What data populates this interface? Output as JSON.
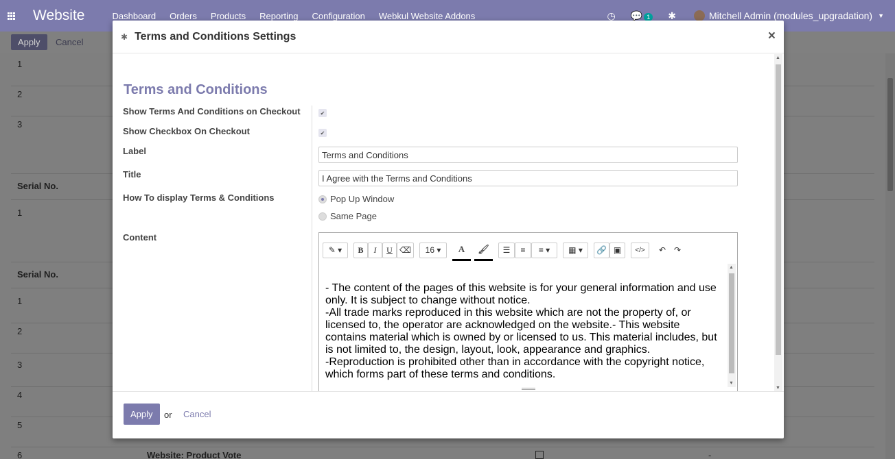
{
  "app": {
    "brand": "Website",
    "menu": [
      "Dashboard",
      "Orders",
      "Products",
      "Reporting",
      "Configuration",
      "Webkul Website Addons"
    ],
    "chat_badge": "1",
    "user": "Mitchell Admin (modules_upgradation)"
  },
  "control_panel": {
    "apply": "Apply",
    "cancel": "Cancel"
  },
  "background": {
    "rows_top": [
      "1",
      "2",
      "3"
    ],
    "serial_header": "Serial No.",
    "rows_mid": [
      "1"
    ],
    "rows_bottom": [
      "1",
      "2",
      "3",
      "4",
      "5",
      "6"
    ],
    "last_row_text": "Website: Product Vote",
    "last_row_dash": "-"
  },
  "dialog": {
    "title": "Terms and Conditions Settings",
    "close": "×",
    "section_title": "Terms and Conditions",
    "fields": {
      "show_terms_label": "Show Terms And Conditions on Checkout",
      "show_checkbox_label": "Show Checkbox On Checkout",
      "label_label": "Label",
      "label_value": "Terms and Conditions",
      "title_label": "Title",
      "title_value": "I Agree with the Terms and Conditions",
      "display_label": "How To display Terms & Conditions",
      "display_options": [
        "Pop Up Window",
        "Same Page"
      ],
      "content_label": "Content"
    },
    "editor": {
      "font_size": "16",
      "lines": [
        "- The content of the pages of this website is for your general information and use only. It is subject to change without notice.",
        "-All trade marks reproduced in this website which are not the property of, or licensed to, the operator are acknowledged on the website.- This website contains material which is owned by or licensed to us. This material includes, but is not limited to, the design, layout, look, appearance and graphics.",
        "-Reproduction is prohibited other than in accordance with the copyright notice, which forms part of these terms and conditions."
      ]
    },
    "footer": {
      "apply": "Apply",
      "or": "or",
      "cancel": "Cancel"
    }
  }
}
